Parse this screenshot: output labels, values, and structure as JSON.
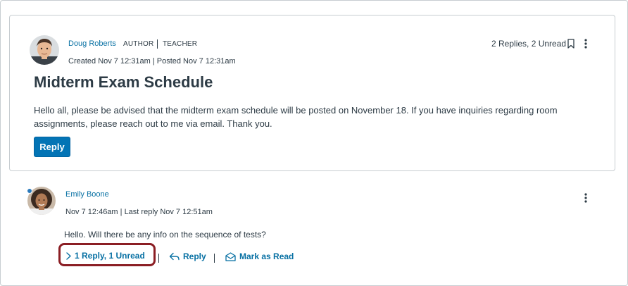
{
  "topic": {
    "author_name": "Doug Roberts",
    "roles": [
      "AUTHOR",
      "TEACHER"
    ],
    "meta": "Created Nov 7 12:31am  | Posted Nov 7 12:31am",
    "reply_count": "2 Replies, 2 Unread",
    "title": "Midterm Exam Schedule",
    "body": "Hello all, please be advised that the midterm exam schedule will be posted on November 18. If you have inquiries regarding room assignments, please reach out to me via email. Thank you.",
    "reply_label": "Reply"
  },
  "entry": {
    "author_name": "Emily Boone",
    "meta": "Nov 7 12:46am  | Last reply Nov 7 12:51am",
    "text": "Hello. Will there be any info on the sequence of tests?",
    "expand_label": "1 Reply, 1 Unread",
    "reply_label": "Reply",
    "mark_read_label": "Mark as Read"
  },
  "icons": {
    "bookmark": "bookmark-icon",
    "more": "more-options-icon",
    "chevron": "chevron-right-icon",
    "reply": "reply-arrow-icon",
    "mark_read": "envelope-open-icon"
  },
  "colors": {
    "link": "#0770a3",
    "primary_button": "#0374b5",
    "text": "#2d3b45",
    "highlight": "#8b1e24",
    "unread_dot": "#2b7abc"
  }
}
